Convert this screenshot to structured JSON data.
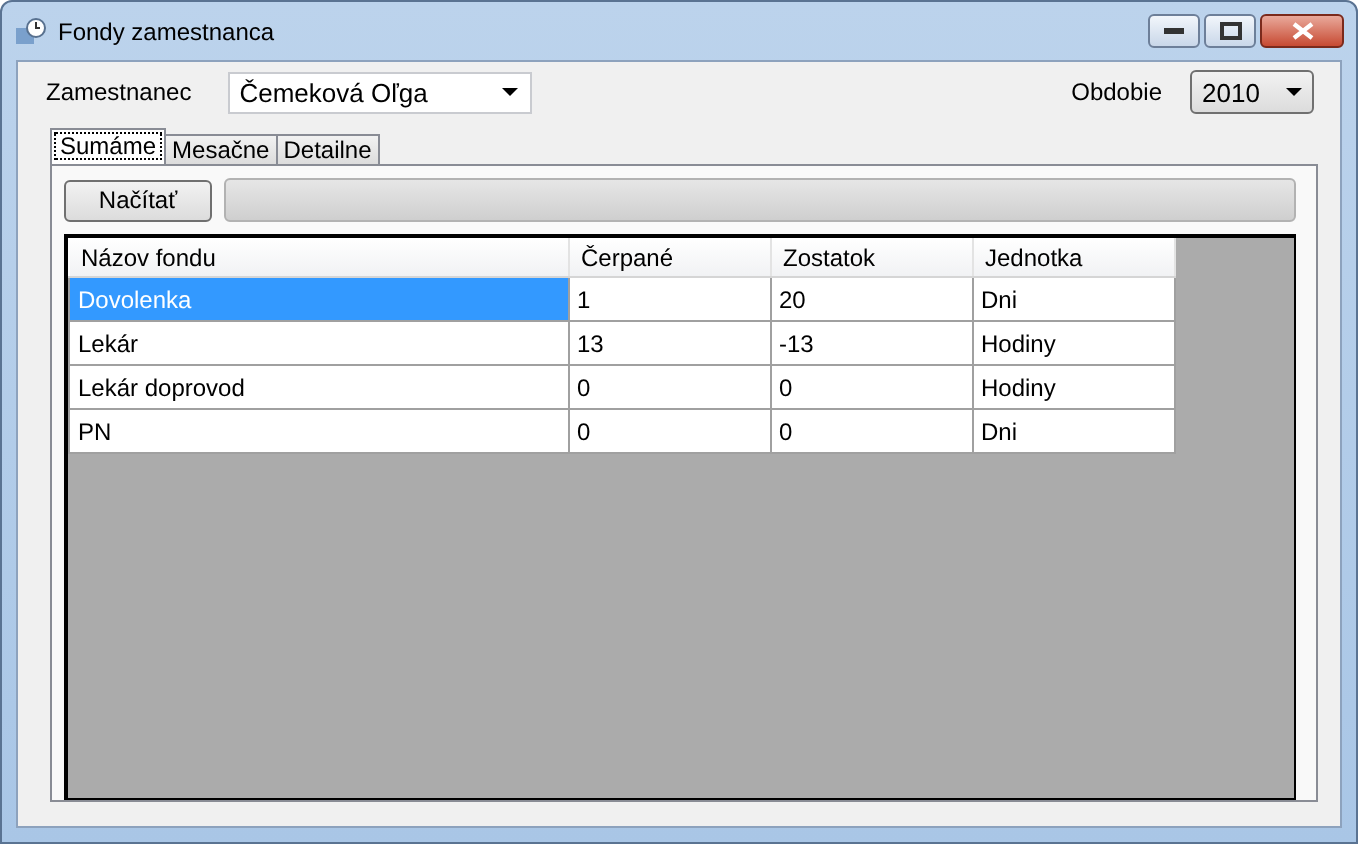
{
  "window": {
    "title": "Fondy zamestnanca"
  },
  "employee": {
    "label": "Zamestnanec",
    "value": "Čemeková Oľga"
  },
  "period": {
    "label": "Obdobie",
    "value": "2010"
  },
  "tabs": [
    {
      "label": "Sumáme",
      "selected": true
    },
    {
      "label": "Mesačne",
      "selected": false
    },
    {
      "label": "Detailne",
      "selected": false
    }
  ],
  "load_button": "Načítať",
  "progress": {
    "level": 0
  },
  "table": {
    "columns": [
      "Názov fondu",
      "Čerpané",
      "Zostatok",
      "Jednotka"
    ],
    "rows": [
      {
        "cells": [
          "Dovolenka",
          "1",
          "20",
          "Dni"
        ],
        "selected": true
      },
      {
        "cells": [
          "Lekár",
          "13",
          "-13",
          "Hodiny"
        ],
        "selected": false
      },
      {
        "cells": [
          "Lekár doprovod",
          "0",
          "0",
          "Hodiny"
        ],
        "selected": false
      },
      {
        "cells": [
          "PN",
          "0",
          "0",
          "Dni"
        ],
        "selected": false
      }
    ]
  }
}
